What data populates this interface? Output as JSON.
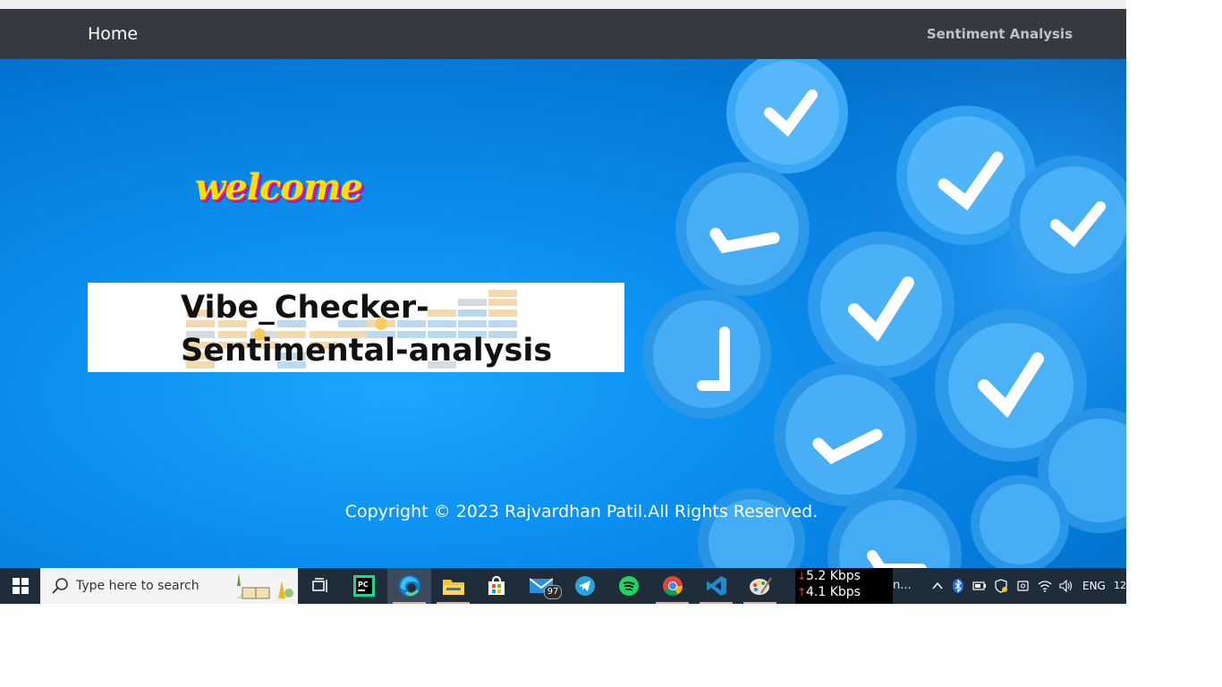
{
  "navbar": {
    "home_label": "Home",
    "sentiment_label": "Sentiment Analysis"
  },
  "hero": {
    "welcome_text": "welcome",
    "title": "Vibe_Checker-Sentimental-analysis",
    "copyright": "Copyright © 2023 Rajvardhan Patil.All Rights Reserved."
  },
  "taskbar": {
    "search_placeholder": "Type here to search",
    "mail_badge": "97",
    "net_down": "5.2 Kbps",
    "net_up": "4.1 Kbps",
    "tray_truncated": "n...",
    "language": "ENG",
    "clock": "12"
  },
  "colors": {
    "navbar": "#343a40",
    "hero_blue": "#0b8ff0",
    "taskbar": "#1f2d3a"
  }
}
